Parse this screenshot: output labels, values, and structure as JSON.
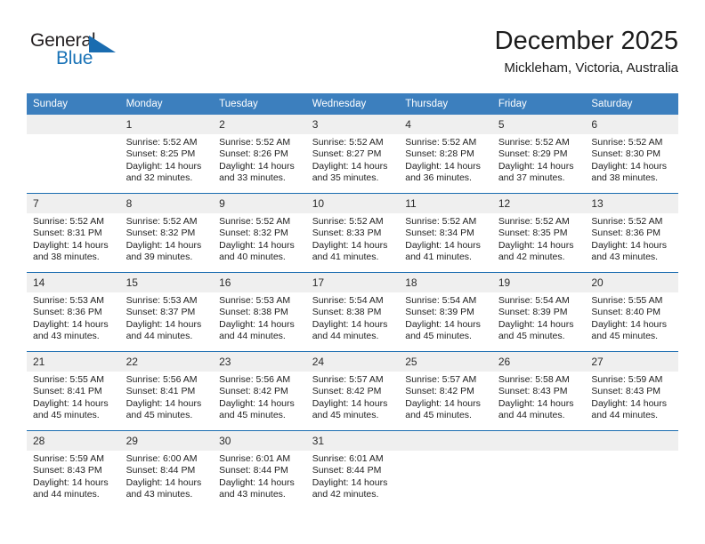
{
  "logo": {
    "word_one": "General",
    "word_two": "Blue",
    "triangle_icon": "triangle-icon"
  },
  "header": {
    "title": "December 2025",
    "location": "Mickleham, Victoria, Australia"
  },
  "colors": {
    "header_blue": "#3c7fbe",
    "rule_blue": "#1a6cb0",
    "daynum_band": "#efefef",
    "logo_blue": "#1a73b7"
  },
  "calendar": {
    "weekday_headers": [
      "Sunday",
      "Monday",
      "Tuesday",
      "Wednesday",
      "Thursday",
      "Friday",
      "Saturday"
    ],
    "weeks": [
      [
        {
          "day": "",
          "detail": "",
          "empty": true
        },
        {
          "day": "1",
          "detail": "Sunrise: 5:52 AM\nSunset: 8:25 PM\nDaylight: 14 hours and 32 minutes."
        },
        {
          "day": "2",
          "detail": "Sunrise: 5:52 AM\nSunset: 8:26 PM\nDaylight: 14 hours and 33 minutes."
        },
        {
          "day": "3",
          "detail": "Sunrise: 5:52 AM\nSunset: 8:27 PM\nDaylight: 14 hours and 35 minutes."
        },
        {
          "day": "4",
          "detail": "Sunrise: 5:52 AM\nSunset: 8:28 PM\nDaylight: 14 hours and 36 minutes."
        },
        {
          "day": "5",
          "detail": "Sunrise: 5:52 AM\nSunset: 8:29 PM\nDaylight: 14 hours and 37 minutes."
        },
        {
          "day": "6",
          "detail": "Sunrise: 5:52 AM\nSunset: 8:30 PM\nDaylight: 14 hours and 38 minutes."
        }
      ],
      [
        {
          "day": "7",
          "detail": "Sunrise: 5:52 AM\nSunset: 8:31 PM\nDaylight: 14 hours and 38 minutes."
        },
        {
          "day": "8",
          "detail": "Sunrise: 5:52 AM\nSunset: 8:32 PM\nDaylight: 14 hours and 39 minutes."
        },
        {
          "day": "9",
          "detail": "Sunrise: 5:52 AM\nSunset: 8:32 PM\nDaylight: 14 hours and 40 minutes."
        },
        {
          "day": "10",
          "detail": "Sunrise: 5:52 AM\nSunset: 8:33 PM\nDaylight: 14 hours and 41 minutes."
        },
        {
          "day": "11",
          "detail": "Sunrise: 5:52 AM\nSunset: 8:34 PM\nDaylight: 14 hours and 41 minutes."
        },
        {
          "day": "12",
          "detail": "Sunrise: 5:52 AM\nSunset: 8:35 PM\nDaylight: 14 hours and 42 minutes."
        },
        {
          "day": "13",
          "detail": "Sunrise: 5:52 AM\nSunset: 8:36 PM\nDaylight: 14 hours and 43 minutes."
        }
      ],
      [
        {
          "day": "14",
          "detail": "Sunrise: 5:53 AM\nSunset: 8:36 PM\nDaylight: 14 hours and 43 minutes."
        },
        {
          "day": "15",
          "detail": "Sunrise: 5:53 AM\nSunset: 8:37 PM\nDaylight: 14 hours and 44 minutes."
        },
        {
          "day": "16",
          "detail": "Sunrise: 5:53 AM\nSunset: 8:38 PM\nDaylight: 14 hours and 44 minutes."
        },
        {
          "day": "17",
          "detail": "Sunrise: 5:54 AM\nSunset: 8:38 PM\nDaylight: 14 hours and 44 minutes."
        },
        {
          "day": "18",
          "detail": "Sunrise: 5:54 AM\nSunset: 8:39 PM\nDaylight: 14 hours and 45 minutes."
        },
        {
          "day": "19",
          "detail": "Sunrise: 5:54 AM\nSunset: 8:39 PM\nDaylight: 14 hours and 45 minutes."
        },
        {
          "day": "20",
          "detail": "Sunrise: 5:55 AM\nSunset: 8:40 PM\nDaylight: 14 hours and 45 minutes."
        }
      ],
      [
        {
          "day": "21",
          "detail": "Sunrise: 5:55 AM\nSunset: 8:41 PM\nDaylight: 14 hours and 45 minutes."
        },
        {
          "day": "22",
          "detail": "Sunrise: 5:56 AM\nSunset: 8:41 PM\nDaylight: 14 hours and 45 minutes."
        },
        {
          "day": "23",
          "detail": "Sunrise: 5:56 AM\nSunset: 8:42 PM\nDaylight: 14 hours and 45 minutes."
        },
        {
          "day": "24",
          "detail": "Sunrise: 5:57 AM\nSunset: 8:42 PM\nDaylight: 14 hours and 45 minutes."
        },
        {
          "day": "25",
          "detail": "Sunrise: 5:57 AM\nSunset: 8:42 PM\nDaylight: 14 hours and 45 minutes."
        },
        {
          "day": "26",
          "detail": "Sunrise: 5:58 AM\nSunset: 8:43 PM\nDaylight: 14 hours and 44 minutes."
        },
        {
          "day": "27",
          "detail": "Sunrise: 5:59 AM\nSunset: 8:43 PM\nDaylight: 14 hours and 44 minutes."
        }
      ],
      [
        {
          "day": "28",
          "detail": "Sunrise: 5:59 AM\nSunset: 8:43 PM\nDaylight: 14 hours and 44 minutes."
        },
        {
          "day": "29",
          "detail": "Sunrise: 6:00 AM\nSunset: 8:44 PM\nDaylight: 14 hours and 43 minutes."
        },
        {
          "day": "30",
          "detail": "Sunrise: 6:01 AM\nSunset: 8:44 PM\nDaylight: 14 hours and 43 minutes."
        },
        {
          "day": "31",
          "detail": "Sunrise: 6:01 AM\nSunset: 8:44 PM\nDaylight: 14 hours and 42 minutes."
        },
        {
          "day": "",
          "detail": "",
          "empty": true
        },
        {
          "day": "",
          "detail": "",
          "empty": true
        },
        {
          "day": "",
          "detail": "",
          "empty": true
        }
      ]
    ]
  }
}
